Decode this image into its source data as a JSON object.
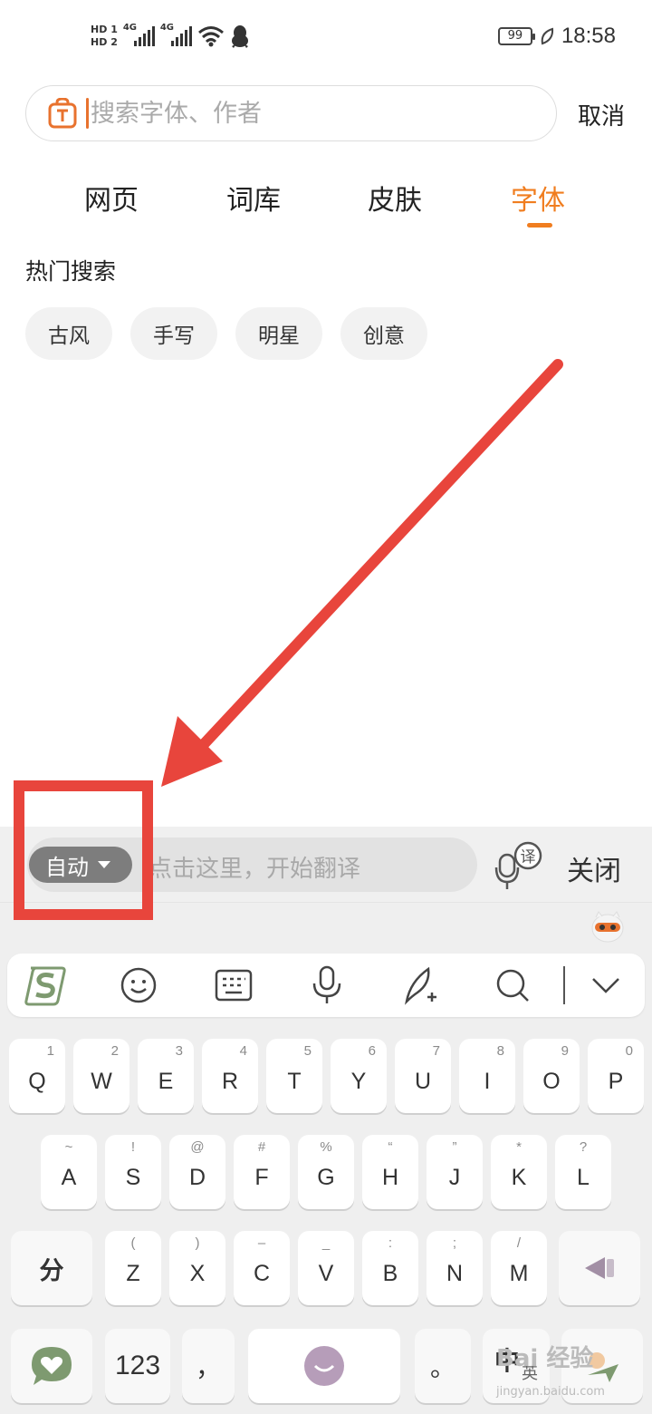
{
  "status_bar": {
    "hd1": "HD",
    "hd1_num": "1",
    "hd2": "HD",
    "hd2_num": "2",
    "signal_gen_1": "4G",
    "signal_gen_2": "4G",
    "battery": "99",
    "time": "18:58"
  },
  "search": {
    "placeholder": "搜索字体、作者",
    "cancel_label": "取消"
  },
  "tabs": [
    {
      "label": "网页",
      "active": false
    },
    {
      "label": "词库",
      "active": false
    },
    {
      "label": "皮肤",
      "active": false
    },
    {
      "label": "字体",
      "active": true
    }
  ],
  "hot_search": {
    "title": "热门搜索",
    "chips": [
      "古风",
      "手写",
      "明星",
      "创意"
    ]
  },
  "translate_bar": {
    "mode_label": "自动",
    "placeholder": "点击这里，开始翻译",
    "translate_badge": "译",
    "close_label": "关闭"
  },
  "keyboard": {
    "toolbar_icons": [
      "sogou-logo-icon",
      "emoji-icon",
      "keyboard-icon",
      "microphone-icon",
      "handwriting-icon",
      "search-icon",
      "collapse-icon"
    ],
    "row1": [
      {
        "key": "Q",
        "sub": "1"
      },
      {
        "key": "W",
        "sub": "2"
      },
      {
        "key": "E",
        "sub": "3"
      },
      {
        "key": "R",
        "sub": "4"
      },
      {
        "key": "T",
        "sub": "5"
      },
      {
        "key": "Y",
        "sub": "6"
      },
      {
        "key": "U",
        "sub": "7"
      },
      {
        "key": "I",
        "sub": "8"
      },
      {
        "key": "O",
        "sub": "9"
      },
      {
        "key": "P",
        "sub": "0"
      }
    ],
    "row2": [
      {
        "key": "A",
        "sub": "~"
      },
      {
        "key": "S",
        "sub": "!"
      },
      {
        "key": "D",
        "sub": "@"
      },
      {
        "key": "F",
        "sub": "#"
      },
      {
        "key": "G",
        "sub": "%"
      },
      {
        "key": "H",
        "sub": "“"
      },
      {
        "key": "J",
        "sub": "”"
      },
      {
        "key": "K",
        "sub": "*"
      },
      {
        "key": "L",
        "sub": "?"
      }
    ],
    "row3": [
      {
        "key": "Z",
        "sub": "("
      },
      {
        "key": "X",
        "sub": ")"
      },
      {
        "key": "C",
        "sub": "–"
      },
      {
        "key": "V",
        "sub": "_"
      },
      {
        "key": "B",
        "sub": ":"
      },
      {
        "key": "N",
        "sub": ";"
      },
      {
        "key": "M",
        "sub": "/"
      }
    ],
    "split_label": "分",
    "numbers_label": "123",
    "comma_label": "，",
    "period_label": "。",
    "lang_primary": "中",
    "lang_secondary": "英"
  },
  "watermark": {
    "text": "Bai 经验",
    "sub": "jingyan.baidu.com"
  },
  "colors": {
    "accent": "#f07d1f",
    "annotation": "#e8453c"
  }
}
